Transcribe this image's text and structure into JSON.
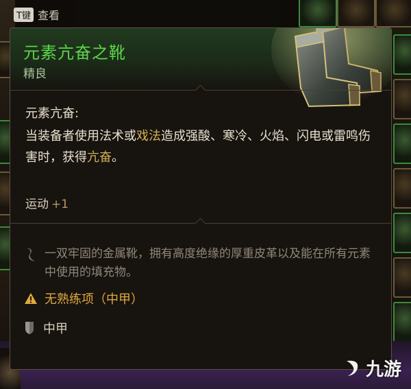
{
  "hotkey": {
    "key": "T键",
    "label": "查看"
  },
  "item": {
    "name": "元素亢奋之靴",
    "rarity": "精良",
    "rarity_color": "#5cd64a",
    "image_icon": "boots-icon"
  },
  "passive": {
    "title": "元素亢奋:",
    "desc_part1": "当装备者使用法术或",
    "desc_highlight1": "戏法",
    "desc_part2": "造成强酸、寒冷、火焰、闪电或雷鸣伤害时，获得",
    "desc_highlight2": "亢奋",
    "desc_part3": "。"
  },
  "stat": {
    "label": "运动",
    "value": "+1"
  },
  "lore": {
    "icon": "quill-icon",
    "text": "一双牢固的金属靴，拥有高度绝缘的厚重皮革以及能在所有元素中使用的填充物。"
  },
  "proficiency_warning": {
    "icon": "warning-icon",
    "text": "无熟练项（中甲）",
    "color": "#e0a93c"
  },
  "armor_type": {
    "icon": "shield-icon",
    "text": "中甲"
  },
  "watermark": {
    "text": "九游"
  }
}
